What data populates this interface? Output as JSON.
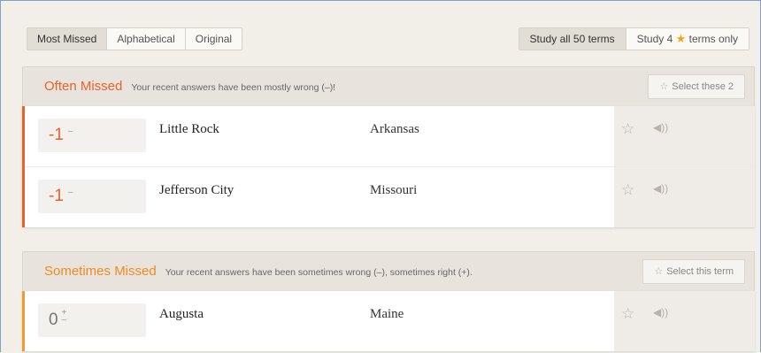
{
  "toolbar": {
    "sort_tabs": [
      {
        "label": "Most Missed",
        "active": true
      },
      {
        "label": "Alphabetical",
        "active": false
      },
      {
        "label": "Original",
        "active": false
      }
    ],
    "study_all_label": "Study all 50 terms",
    "study_starred_prefix": "Study 4",
    "study_starred_suffix": "terms only",
    "star_icon": "star-filled-icon"
  },
  "often": {
    "title": "Often Missed",
    "description": "Your recent answers have been mostly wrong (–)!",
    "select_label": "Select these 2",
    "accent": "#e8622a",
    "rows": [
      {
        "score": "-1",
        "score_mark": "–",
        "term": "Little Rock",
        "definition": "Arkansas"
      },
      {
        "score": "-1",
        "score_mark": "–",
        "term": "Jefferson City",
        "definition": "Missouri"
      }
    ]
  },
  "sometimes": {
    "title": "Sometimes Missed",
    "description": "Your recent answers have been sometimes wrong (–), sometimes right (+).",
    "select_label": "Select this term",
    "accent": "#ef9c2c",
    "rows": [
      {
        "score": "0",
        "score_mark_top": "+",
        "score_mark_bottom": "–",
        "term": "Augusta",
        "definition": "Maine"
      }
    ]
  },
  "icons": {
    "star_outline": "☆",
    "speaker": "◀))"
  }
}
